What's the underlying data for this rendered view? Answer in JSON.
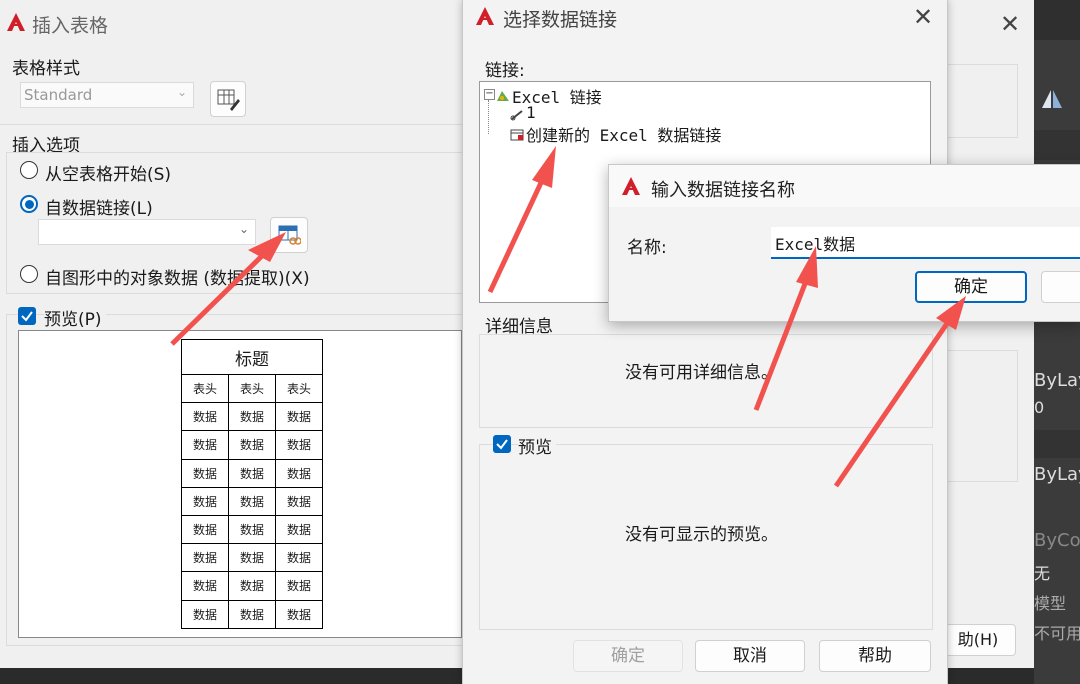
{
  "colors": {
    "accent": "#0067c0",
    "autocad_red": "#d01f2a",
    "arrow": "#f2524d"
  },
  "insert_table": {
    "title": "插入表格",
    "table_style_label": "表格样式",
    "table_style_value": "Standard",
    "insert_options_label": "插入选项",
    "opt_empty": "从空表格开始(S)",
    "opt_datalink": "自数据链接(L)",
    "opt_object_data": "自图形中的对象数据 (数据提取)(X)",
    "preview_label": "预览(P)",
    "preview_title": "标题",
    "preview_header": "表头",
    "preview_cell": "数据",
    "help_button": "助(H)"
  },
  "select_link": {
    "title": "选择数据链接",
    "links_label": "链接:",
    "tree_root": "Excel 链接",
    "tree_item1": "1",
    "tree_item2": "创建新的 Excel 数据链接",
    "details_label": "详细信息",
    "details_text": "没有可用详细信息。",
    "preview_label": "预览",
    "preview_text": "没有可显示的预览。",
    "ok_button": "确定",
    "cancel_button": "取消",
    "help_button": "帮助"
  },
  "name_dialog": {
    "title": "输入数据链接名称",
    "name_label": "名称:",
    "name_value": "Excel数据",
    "ok_button": "确定"
  },
  "right_panel": {
    "prop1": "ByLay",
    "prop2": "0",
    "prop3": "ByLay",
    "prop4": "ByCol",
    "prop5": "无",
    "prop6": "模型",
    "prop7": "不可用"
  }
}
